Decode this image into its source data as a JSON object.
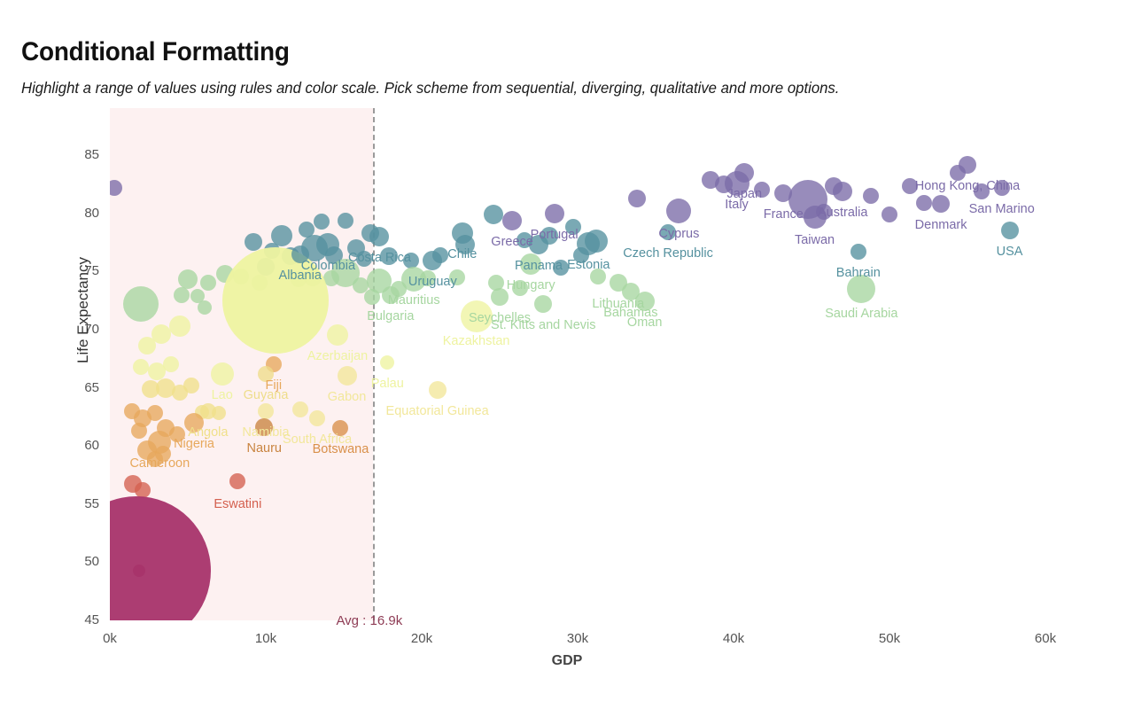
{
  "header": {
    "title": "Conditional Formatting",
    "subtitle": "Highlight a range of values using rules and color scale. Pick scheme from sequential, diverging, qualitative and more options."
  },
  "axes": {
    "x_title": "GDP",
    "y_title": "Life Expectancy",
    "x_ticks": [
      "0k",
      "10k",
      "20k",
      "30k",
      "40k",
      "50k",
      "60k"
    ],
    "y_ticks": [
      "85",
      "80",
      "75",
      "70",
      "65",
      "60",
      "55",
      "50",
      "45"
    ]
  },
  "annotation": {
    "avg_label": "Avg : 16.9k",
    "avg_color": "#8e3c55",
    "shade_color": "#fdf1f1",
    "line_color": "#9a9a9a"
  },
  "palette": {
    "purple": "#7b6ba8",
    "blue": "#55919f",
    "green": "#a6d6a0",
    "yellow": "#eef3a0",
    "orange": "#e7a85c",
    "red": "#d4604f",
    "magenta": "#a8336a"
  },
  "chart_data": {
    "type": "scatter",
    "title": "Conditional Formatting",
    "xlabel": "GDP",
    "ylabel": "Life Expectancy",
    "xlim": [
      0,
      62000
    ],
    "ylim": [
      45,
      86
    ],
    "grid": false,
    "legend": "none",
    "size_encoding": "population",
    "color_encoding": "life expectancy (Spectral scale)",
    "avg_x": 16900,
    "points": [
      {
        "label": "",
        "x": 300,
        "y": 82.2,
        "r": 9,
        "c": "#7b6ba8"
      },
      {
        "label": "Colombia",
        "x": 14000,
        "y": 77.3,
        "r": 13,
        "c": "#55919f",
        "lx": 0,
        "ly": 16
      },
      {
        "label": "Albania",
        "x": 12200,
        "y": 76.5,
        "r": 10,
        "c": "#55919f",
        "lx": 0,
        "ly": 16
      },
      {
        "label": "Costa Rica",
        "x": 17300,
        "y": 78.0,
        "r": 11,
        "c": "#55919f",
        "lx": 0,
        "ly": 16
      },
      {
        "label": "Chile",
        "x": 22600,
        "y": 78.3,
        "r": 12,
        "c": "#55919f",
        "lx": 0,
        "ly": 16
      },
      {
        "label": "Uruguay",
        "x": 20700,
        "y": 75.9,
        "r": 11,
        "c": "#55919f",
        "lx": 0,
        "ly": 16
      },
      {
        "label": "Greece",
        "x": 25800,
        "y": 79.4,
        "r": 11,
        "c": "#7b6ba8",
        "lx": 0,
        "ly": 16
      },
      {
        "label": "Portugal",
        "x": 28500,
        "y": 80.0,
        "r": 11,
        "c": "#7b6ba8",
        "lx": 0,
        "ly": 16
      },
      {
        "label": "Panama",
        "x": 27500,
        "y": 77.3,
        "r": 11,
        "c": "#55919f",
        "lx": 0,
        "ly": 16
      },
      {
        "label": "Estonia",
        "x": 30700,
        "y": 77.4,
        "r": 13,
        "c": "#55919f",
        "lx": 0,
        "ly": 16
      },
      {
        "label": "Hungary",
        "x": 27000,
        "y": 75.6,
        "r": 12,
        "c": "#a6d6a0",
        "lx": 0,
        "ly": 16
      },
      {
        "label": "Mauritius",
        "x": 19500,
        "y": 74.3,
        "r": 14,
        "c": "#a6d6a0",
        "lx": 0,
        "ly": 16
      },
      {
        "label": "Bulgaria",
        "x": 18000,
        "y": 73.0,
        "r": 10,
        "c": "#a6d6a0",
        "lx": 0,
        "ly": 16
      },
      {
        "label": "Seychelles",
        "x": 25000,
        "y": 72.8,
        "r": 10,
        "c": "#a6d6a0",
        "lx": 0,
        "ly": 16
      },
      {
        "label": "St. Kitts and Nevis",
        "x": 27800,
        "y": 72.2,
        "r": 10,
        "c": "#a6d6a0",
        "lx": 0,
        "ly": 16
      },
      {
        "label": "Lithuania",
        "x": 32600,
        "y": 74.0,
        "r": 10,
        "c": "#a6d6a0",
        "lx": 0,
        "ly": 16
      },
      {
        "label": "Bahamas",
        "x": 33400,
        "y": 73.3,
        "r": 10,
        "c": "#a6d6a0",
        "lx": 0,
        "ly": 16
      },
      {
        "label": "Oman",
        "x": 34300,
        "y": 72.4,
        "r": 11,
        "c": "#a6d6a0",
        "lx": 0,
        "ly": 16
      },
      {
        "label": "Kazakhstan",
        "x": 23500,
        "y": 71.1,
        "r": 18,
        "c": "#eef3a0",
        "lx": 0,
        "ly": 20
      },
      {
        "label": "Cyprus",
        "x": 36500,
        "y": 80.2,
        "r": 14,
        "c": "#7b6ba8",
        "lx": 0,
        "ly": 18
      },
      {
        "label": "Czech Republic",
        "x": 35800,
        "y": 78.4,
        "r": 9,
        "c": "#55919f",
        "lx": 0,
        "ly": 16
      },
      {
        "label": "Japan",
        "x": 40700,
        "y": 83.5,
        "r": 11,
        "c": "#7b6ba8",
        "lx": 0,
        "ly": 16
      },
      {
        "label": "Italy",
        "x": 40200,
        "y": 82.6,
        "r": 14,
        "c": "#7b6ba8",
        "lx": 0,
        "ly": 16
      },
      {
        "label": "France",
        "x": 43200,
        "y": 81.7,
        "r": 10,
        "c": "#7b6ba8",
        "lx": 0,
        "ly": 16
      },
      {
        "label": "Australia",
        "x": 47000,
        "y": 81.9,
        "r": 11,
        "c": "#7b6ba8",
        "lx": 0,
        "ly": 16
      },
      {
        "label": "Taiwan",
        "x": 45200,
        "y": 79.7,
        "r": 13,
        "c": "#7b6ba8",
        "lx": 0,
        "ly": 18
      },
      {
        "label": "Bahrain",
        "x": 48000,
        "y": 76.7,
        "r": 9,
        "c": "#55919f",
        "lx": 0,
        "ly": 16
      },
      {
        "label": "Saudi Arabia",
        "x": 48200,
        "y": 73.5,
        "r": 16,
        "c": "#a6d6a0",
        "lx": 0,
        "ly": 20
      },
      {
        "label": "Denmark",
        "x": 53300,
        "y": 80.8,
        "r": 10,
        "c": "#7b6ba8",
        "lx": 0,
        "ly": 16
      },
      {
        "label": "Hong Kong, China",
        "x": 55000,
        "y": 84.2,
        "r": 10,
        "c": "#7b6ba8",
        "lx": 0,
        "ly": 16
      },
      {
        "label": "San Marino",
        "x": 57200,
        "y": 82.2,
        "r": 9,
        "c": "#7b6ba8",
        "lx": 0,
        "ly": 16
      },
      {
        "label": "USA",
        "x": 57700,
        "y": 78.5,
        "r": 10,
        "c": "#55919f",
        "lx": 0,
        "ly": 16
      },
      {
        "label": "Azerbaijan",
        "x": 14600,
        "y": 69.5,
        "r": 12,
        "c": "#eef3a0",
        "lx": 0,
        "ly": 16
      },
      {
        "label": "Lao",
        "x": 7200,
        "y": 66.2,
        "r": 13,
        "c": "#eef3a0",
        "lx": 0,
        "ly": 16
      },
      {
        "label": "Fiji",
        "x": 10500,
        "y": 67.0,
        "r": 9,
        "c": "#e7a85c",
        "lx": 0,
        "ly": 16
      },
      {
        "label": "Guyana",
        "x": 10000,
        "y": 66.2,
        "r": 9,
        "c": "#eedd8a",
        "lx": 0,
        "ly": 16
      },
      {
        "label": "Gabon",
        "x": 15200,
        "y": 66.0,
        "r": 11,
        "c": "#f2e79a",
        "lx": 0,
        "ly": 16
      },
      {
        "label": "Palau",
        "x": 17800,
        "y": 67.2,
        "r": 8,
        "c": "#eef3a0",
        "lx": 0,
        "ly": 16
      },
      {
        "label": "Equatorial Guinea",
        "x": 21000,
        "y": 64.8,
        "r": 10,
        "c": "#f2e79a",
        "lx": 0,
        "ly": 16
      },
      {
        "label": "Angola",
        "x": 6300,
        "y": 63.0,
        "r": 9,
        "c": "#f0e08a",
        "lx": 0,
        "ly": 16
      },
      {
        "label": "Namibia",
        "x": 10000,
        "y": 63.0,
        "r": 9,
        "c": "#f2e79a",
        "lx": 0,
        "ly": 16
      },
      {
        "label": "Nigeria",
        "x": 5400,
        "y": 62.0,
        "r": 11,
        "c": "#e7a85c",
        "lx": 0,
        "ly": 16
      },
      {
        "label": "Nauru",
        "x": 9900,
        "y": 61.6,
        "r": 10,
        "c": "#c98440",
        "lx": 0,
        "ly": 16
      },
      {
        "label": "South Africa",
        "x": 13300,
        "y": 62.4,
        "r": 9,
        "c": "#f2e79a",
        "lx": 0,
        "ly": 16
      },
      {
        "label": "Botswana",
        "x": 14800,
        "y": 61.5,
        "r": 9,
        "c": "#d9904a",
        "lx": 0,
        "ly": 16
      },
      {
        "label": "Cameroon",
        "x": 3200,
        "y": 60.3,
        "r": 13,
        "c": "#e7a85c",
        "lx": 0,
        "ly": 16
      },
      {
        "label": "Eswatini",
        "x": 8200,
        "y": 57.0,
        "r": 9,
        "c": "#d4604f",
        "lx": 0,
        "ly": 18
      },
      {
        "label": "",
        "x": 1700,
        "y": 49.3,
        "r": 84,
        "c": "#a8336a"
      }
    ]
  },
  "background_bubbles": [
    {
      "x": 11000,
      "y": 78.1,
      "r": 12,
      "c": "#55919f"
    },
    {
      "x": 12600,
      "y": 78.6,
      "r": 9,
      "c": "#55919f"
    },
    {
      "x": 13600,
      "y": 79.3,
      "r": 9,
      "c": "#55919f"
    },
    {
      "x": 15100,
      "y": 79.4,
      "r": 9,
      "c": "#55919f"
    },
    {
      "x": 9200,
      "y": 77.5,
      "r": 10,
      "c": "#55919f"
    },
    {
      "x": 10400,
      "y": 76.8,
      "r": 9,
      "c": "#55919f"
    },
    {
      "x": 11600,
      "y": 76.3,
      "r": 10,
      "c": "#55919f"
    },
    {
      "x": 13100,
      "y": 77.0,
      "r": 15,
      "c": "#55919f"
    },
    {
      "x": 14400,
      "y": 76.4,
      "r": 10,
      "c": "#55919f"
    },
    {
      "x": 15800,
      "y": 77.0,
      "r": 10,
      "c": "#55919f"
    },
    {
      "x": 16300,
      "y": 76.1,
      "r": 9,
      "c": "#55919f"
    },
    {
      "x": 10000,
      "y": 75.4,
      "r": 10,
      "c": "#55919f"
    },
    {
      "x": 16700,
      "y": 78.3,
      "r": 10,
      "c": "#55919f"
    },
    {
      "x": 17900,
      "y": 76.3,
      "r": 10,
      "c": "#55919f"
    },
    {
      "x": 19300,
      "y": 75.9,
      "r": 9,
      "c": "#55919f"
    },
    {
      "x": 21200,
      "y": 76.4,
      "r": 9,
      "c": "#55919f"
    },
    {
      "x": 22800,
      "y": 77.3,
      "r": 11,
      "c": "#55919f"
    },
    {
      "x": 24600,
      "y": 79.9,
      "r": 11,
      "c": "#55919f"
    },
    {
      "x": 26600,
      "y": 77.7,
      "r": 9,
      "c": "#55919f"
    },
    {
      "x": 28200,
      "y": 78.1,
      "r": 10,
      "c": "#55919f"
    },
    {
      "x": 29700,
      "y": 78.8,
      "r": 9,
      "c": "#55919f"
    },
    {
      "x": 31200,
      "y": 77.6,
      "r": 13,
      "c": "#55919f"
    },
    {
      "x": 30200,
      "y": 76.4,
      "r": 9,
      "c": "#55919f"
    },
    {
      "x": 28900,
      "y": 75.3,
      "r": 9,
      "c": "#55919f"
    },
    {
      "x": 33800,
      "y": 81.3,
      "r": 10,
      "c": "#7b6ba8"
    },
    {
      "x": 38500,
      "y": 82.9,
      "r": 10,
      "c": "#7b6ba8"
    },
    {
      "x": 39400,
      "y": 82.5,
      "r": 10,
      "c": "#7b6ba8"
    },
    {
      "x": 41800,
      "y": 82.0,
      "r": 9,
      "c": "#7b6ba8"
    },
    {
      "x": 44800,
      "y": 81.2,
      "r": 22,
      "c": "#7b6ba8"
    },
    {
      "x": 46400,
      "y": 82.3,
      "r": 10,
      "c": "#7b6ba8"
    },
    {
      "x": 45800,
      "y": 80.1,
      "r": 9,
      "c": "#7b6ba8"
    },
    {
      "x": 48800,
      "y": 81.5,
      "r": 9,
      "c": "#7b6ba8"
    },
    {
      "x": 51300,
      "y": 82.3,
      "r": 9,
      "c": "#7b6ba8"
    },
    {
      "x": 52200,
      "y": 80.9,
      "r": 9,
      "c": "#7b6ba8"
    },
    {
      "x": 54400,
      "y": 83.5,
      "r": 9,
      "c": "#7b6ba8"
    },
    {
      "x": 55900,
      "y": 81.9,
      "r": 9,
      "c": "#7b6ba8"
    },
    {
      "x": 50000,
      "y": 79.9,
      "r": 9,
      "c": "#7b6ba8"
    },
    {
      "x": 2000,
      "y": 72.2,
      "r": 20,
      "c": "#a6d6a0"
    },
    {
      "x": 5000,
      "y": 74.3,
      "r": 11,
      "c": "#a6d6a0"
    },
    {
      "x": 6300,
      "y": 74.0,
      "r": 9,
      "c": "#a6d6a0"
    },
    {
      "x": 7400,
      "y": 74.8,
      "r": 10,
      "c": "#a6d6a0"
    },
    {
      "x": 8400,
      "y": 74.6,
      "r": 9,
      "c": "#a6d6a0"
    },
    {
      "x": 4600,
      "y": 73.0,
      "r": 9,
      "c": "#a6d6a0"
    },
    {
      "x": 5600,
      "y": 72.9,
      "r": 8,
      "c": "#a6d6a0"
    },
    {
      "x": 6100,
      "y": 71.9,
      "r": 8,
      "c": "#a6d6a0"
    },
    {
      "x": 9600,
      "y": 74.0,
      "r": 9,
      "c": "#a6d6a0"
    },
    {
      "x": 12100,
      "y": 74.3,
      "r": 9,
      "c": "#a6d6a0"
    },
    {
      "x": 13000,
      "y": 74.5,
      "r": 10,
      "c": "#a6d6a0"
    },
    {
      "x": 14200,
      "y": 74.4,
      "r": 9,
      "c": "#a6d6a0"
    },
    {
      "x": 15100,
      "y": 74.9,
      "r": 16,
      "c": "#a6d6a0"
    },
    {
      "x": 16100,
      "y": 73.8,
      "r": 9,
      "c": "#a6d6a0"
    },
    {
      "x": 16800,
      "y": 72.8,
      "r": 9,
      "c": "#a6d6a0"
    },
    {
      "x": 17300,
      "y": 74.2,
      "r": 14,
      "c": "#a6d6a0"
    },
    {
      "x": 18500,
      "y": 73.5,
      "r": 9,
      "c": "#a6d6a0"
    },
    {
      "x": 20400,
      "y": 74.4,
      "r": 9,
      "c": "#a6d6a0"
    },
    {
      "x": 22300,
      "y": 74.5,
      "r": 9,
      "c": "#a6d6a0"
    },
    {
      "x": 24800,
      "y": 74.0,
      "r": 9,
      "c": "#a6d6a0"
    },
    {
      "x": 26300,
      "y": 73.6,
      "r": 9,
      "c": "#a6d6a0"
    },
    {
      "x": 31300,
      "y": 74.6,
      "r": 9,
      "c": "#a6d6a0"
    },
    {
      "x": 10600,
      "y": 72.5,
      "r": 60,
      "c": "#eef3a0"
    },
    {
      "x": 4500,
      "y": 70.3,
      "r": 12,
      "c": "#eef3a0"
    },
    {
      "x": 3300,
      "y": 69.6,
      "r": 11,
      "c": "#eef3a0"
    },
    {
      "x": 2400,
      "y": 68.6,
      "r": 10,
      "c": "#eef3a0"
    },
    {
      "x": 2000,
      "y": 66.8,
      "r": 9,
      "c": "#eef3a0"
    },
    {
      "x": 3000,
      "y": 66.4,
      "r": 10,
      "c": "#eef3a0"
    },
    {
      "x": 3900,
      "y": 67.0,
      "r": 9,
      "c": "#eef3a0"
    },
    {
      "x": 2600,
      "y": 64.9,
      "r": 10,
      "c": "#f0e08a"
    },
    {
      "x": 3600,
      "y": 65.0,
      "r": 11,
      "c": "#f0e08a"
    },
    {
      "x": 4500,
      "y": 64.6,
      "r": 9,
      "c": "#f0e08a"
    },
    {
      "x": 5200,
      "y": 65.2,
      "r": 9,
      "c": "#f0e08a"
    },
    {
      "x": 1400,
      "y": 63.0,
      "r": 9,
      "c": "#e7a85c"
    },
    {
      "x": 2100,
      "y": 62.4,
      "r": 10,
      "c": "#e7a85c"
    },
    {
      "x": 2900,
      "y": 62.8,
      "r": 9,
      "c": "#e7a85c"
    },
    {
      "x": 1900,
      "y": 61.3,
      "r": 9,
      "c": "#e7a85c"
    },
    {
      "x": 3600,
      "y": 61.5,
      "r": 10,
      "c": "#e7a85c"
    },
    {
      "x": 4300,
      "y": 61.0,
      "r": 9,
      "c": "#e7a85c"
    },
    {
      "x": 2400,
      "y": 59.6,
      "r": 11,
      "c": "#e7a85c"
    },
    {
      "x": 2900,
      "y": 58.9,
      "r": 9,
      "c": "#e7a85c"
    },
    {
      "x": 3400,
      "y": 59.3,
      "r": 9,
      "c": "#e7a85c"
    },
    {
      "x": 1500,
      "y": 56.7,
      "r": 10,
      "c": "#d4604f"
    },
    {
      "x": 2100,
      "y": 56.2,
      "r": 9,
      "c": "#d4604f"
    },
    {
      "x": 5900,
      "y": 62.9,
      "r": 8,
      "c": "#f0e08a"
    },
    {
      "x": 7000,
      "y": 62.8,
      "r": 8,
      "c": "#f0e08a"
    },
    {
      "x": 12200,
      "y": 63.1,
      "r": 9,
      "c": "#f2e79a"
    },
    {
      "x": 1900,
      "y": 49.3,
      "r": 7,
      "c": "#8c2a58"
    }
  ]
}
